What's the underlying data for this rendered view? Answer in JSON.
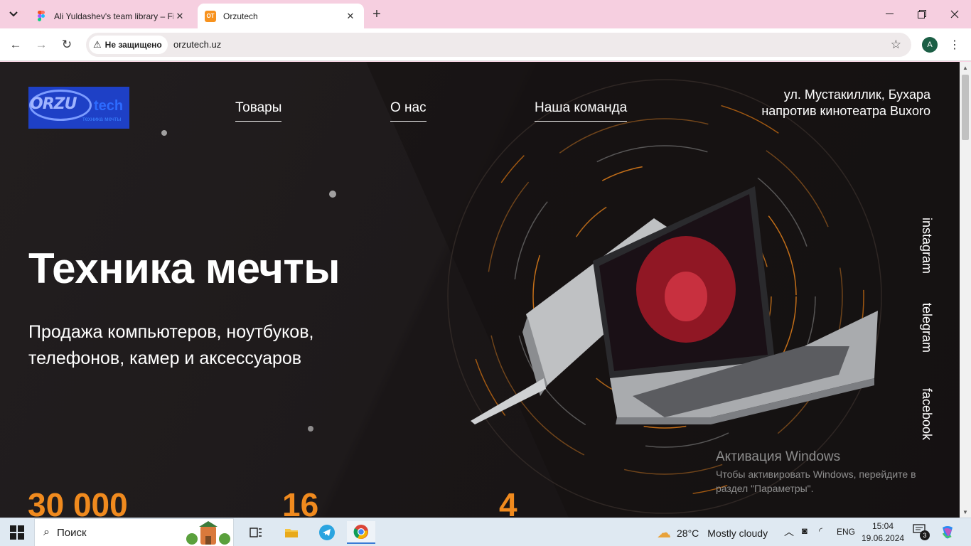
{
  "browser": {
    "tabs": [
      {
        "title": "Ali Yuldashev's team library – Fi",
        "active": false
      },
      {
        "title": "Orzutech",
        "active": true
      }
    ],
    "security_label": "Не защищено",
    "url": "orzutech.uz",
    "profile_initial": "A"
  },
  "site": {
    "logo": {
      "main": "ORZU",
      "tech": "tech",
      "tagline": "техника мечты"
    },
    "nav": [
      "Товары",
      "О нас",
      "Наша команда"
    ],
    "address": {
      "line1": "ул. Мустакиллик, Бухара",
      "line2": "напротив кинотеатра Buxoro"
    },
    "hero": {
      "title": "Техника мечты",
      "subtitle": "Продажа компьютеров, ноутбуков, телефонов, камер и аксессуаров"
    },
    "stats": [
      "30 000",
      "16",
      "4"
    ],
    "social": [
      "instagram",
      "telegram",
      "facebook"
    ],
    "accent_color": "#f08a1e"
  },
  "windows_activation": {
    "title": "Активация Windows",
    "text": "Чтобы активировать Windows, перейдите в раздел \"Параметры\"."
  },
  "taskbar": {
    "search_label": "Поиск",
    "weather": {
      "temp": "28°C",
      "condition": "Mostly cloudy"
    },
    "language": "ENG",
    "time": "15:04",
    "date": "19.06.2024",
    "notifications": "3"
  }
}
